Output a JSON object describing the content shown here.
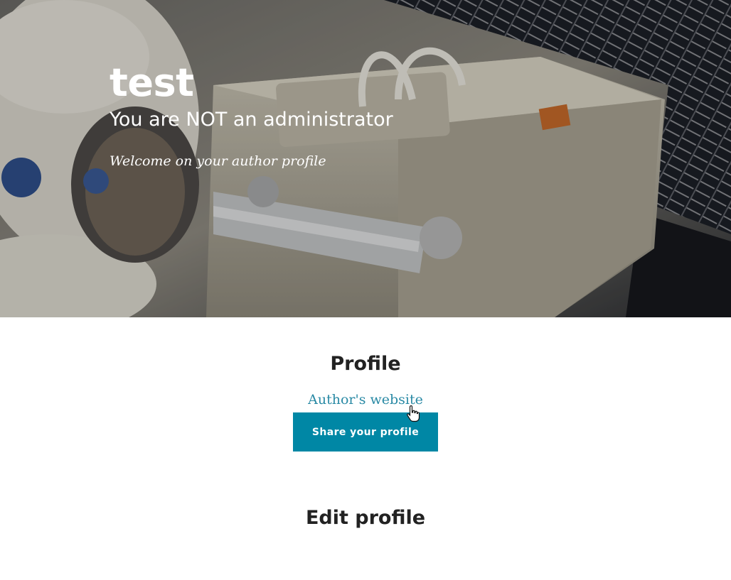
{
  "hero": {
    "title": "test",
    "subtitle": "You are NOT an administrator",
    "meta": "Welcome on your author profile",
    "image_icon": "space-station-photo"
  },
  "profile": {
    "heading": "Profile",
    "website_link": "Author's website",
    "share_label": "Share your profile"
  },
  "edit": {
    "heading": "Edit profile"
  },
  "colors": {
    "accent": "#0087a5",
    "link": "#2a8aa5",
    "heading": "#222222"
  }
}
